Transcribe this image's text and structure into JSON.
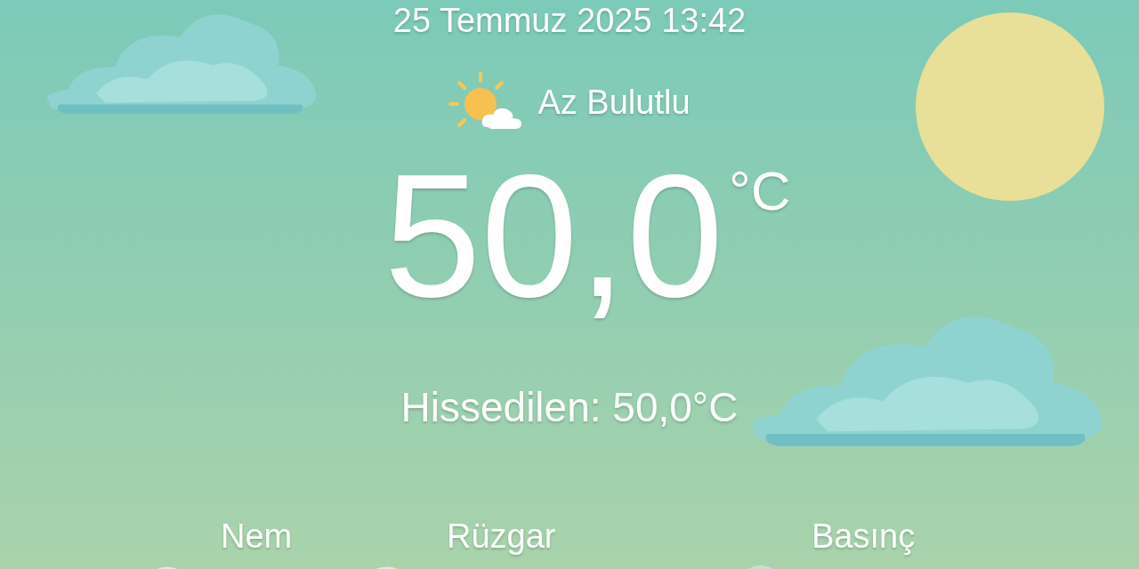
{
  "datetime": "25 Temmuz 2025 13:42",
  "condition": {
    "label": "Az Bulutlu"
  },
  "temperature": {
    "value": "50,0",
    "unit": "°C"
  },
  "feels_like": "Hissedilen: 50,0°C",
  "stats": [
    {
      "kind": "humidity",
      "label": "Nem"
    },
    {
      "kind": "wind",
      "label": "Rüzgar"
    },
    {
      "kind": "pressure",
      "label": "Basınç"
    }
  ]
}
